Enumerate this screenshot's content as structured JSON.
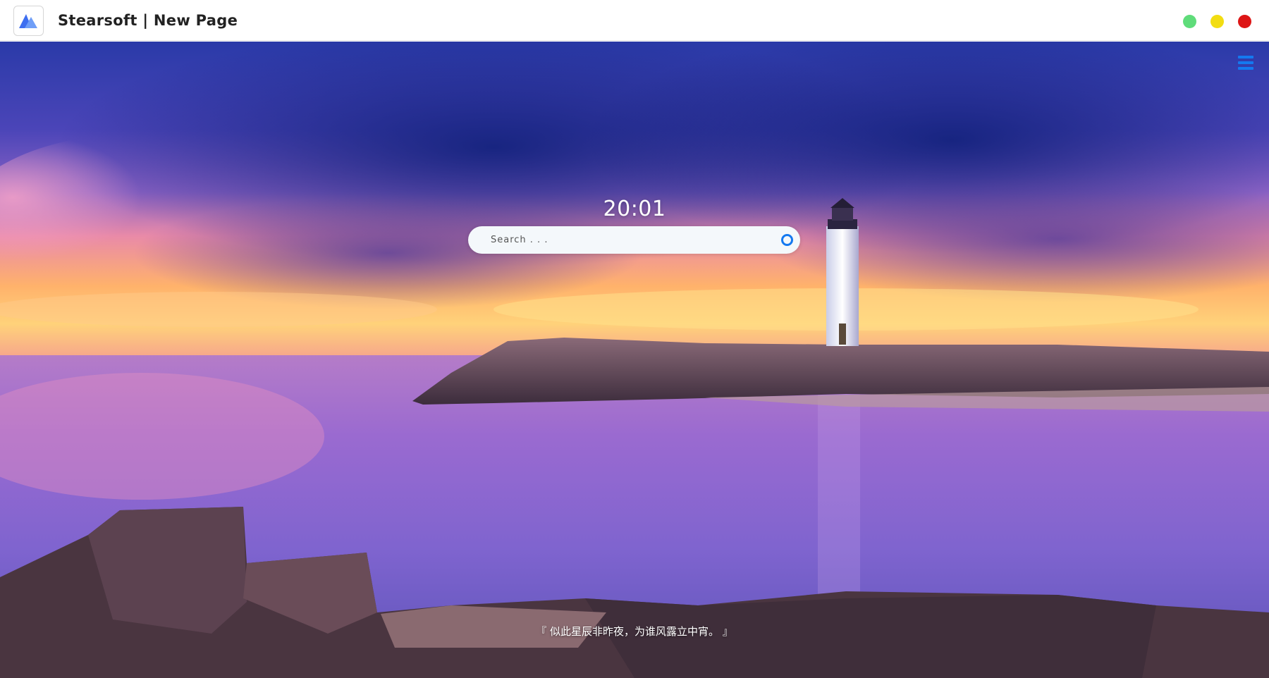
{
  "window": {
    "title": "Stearsoft | New Page",
    "logo_icon": "stearsoft-logo-icon",
    "controls": [
      {
        "name": "maximize",
        "color": "#5fdc7a"
      },
      {
        "name": "minimize",
        "color": "#f2dd12"
      },
      {
        "name": "close",
        "color": "#dd1515"
      }
    ]
  },
  "main": {
    "menu_icon": "hamburger-menu-icon",
    "clock": "20:01",
    "search": {
      "placeholder": "Search . . .",
      "value": "",
      "icon": "search-circle-icon",
      "accent": "#1479f0"
    },
    "quote": "『 似此星辰非昨夜，为谁风露立中宵。 』",
    "background": "lighthouse-sunset-wallpaper"
  }
}
